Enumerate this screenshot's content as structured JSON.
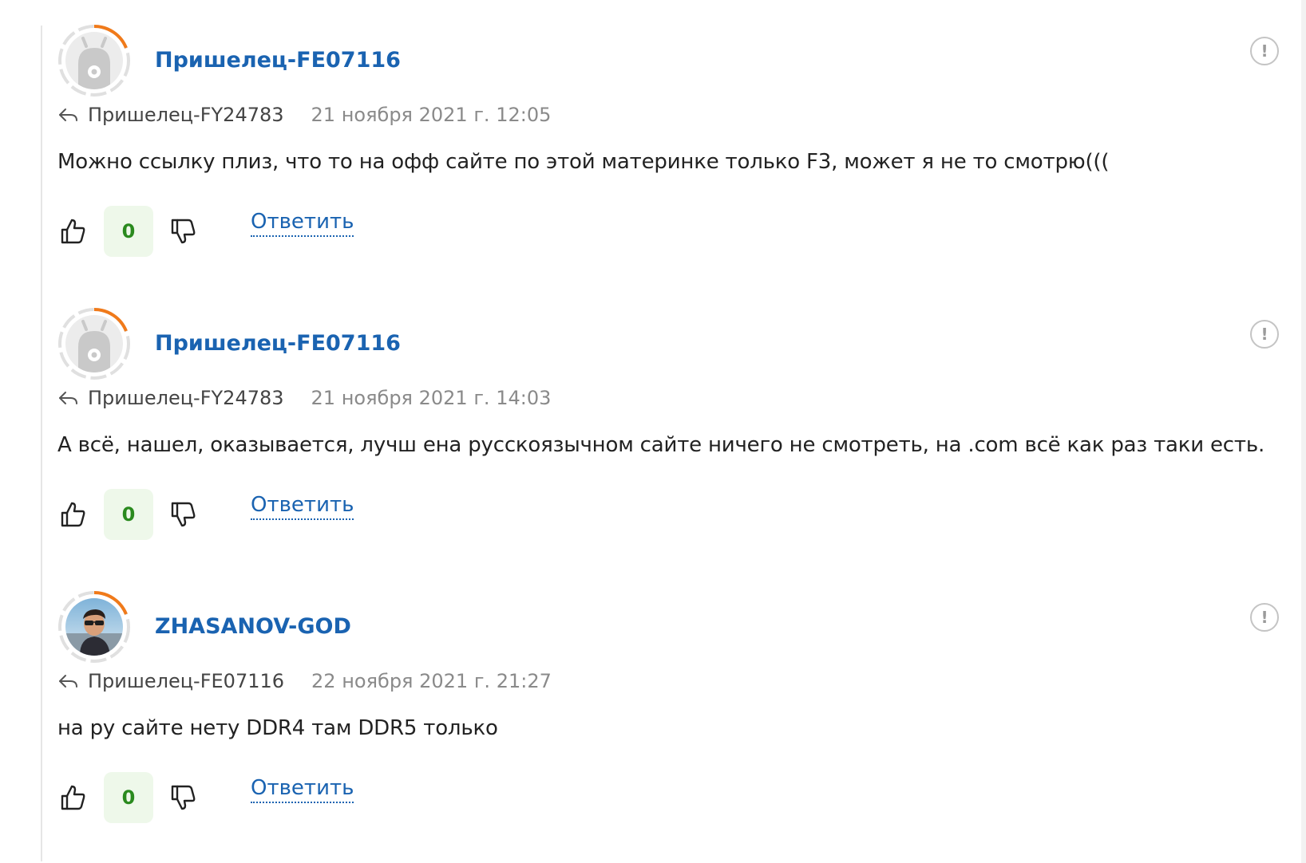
{
  "comments": [
    {
      "avatar": "alien-default-avatar",
      "author": "Пришелец-FE07116",
      "reply_to": "Пришелец-FY24783",
      "date": "21 ноября 2021 г. 12:05",
      "text": "Можно ссылку плиз, что то на офф сайте по этой материнке только F3, может я не то смотрю(((",
      "votes": "0",
      "reply_label": "Ответить",
      "report_symbol": "!"
    },
    {
      "avatar": "alien-default-avatar",
      "author": "Пришелец-FE07116",
      "reply_to": "Пришелец-FY24783",
      "date": "21 ноября 2021 г. 14:03",
      "text": "А всё, нашел, оказывается, лучш ена русскоязычном сайте ничего не смотреть, на .com всё как раз таки есть.",
      "votes": "0",
      "reply_label": "Ответить",
      "report_symbol": "!"
    },
    {
      "avatar": "user-photo-avatar",
      "author": "ZHASANOV-GOD",
      "reply_to": "Пришелец-FE07116",
      "date": "22 ноября 2021 г. 21:27",
      "text": "на ру сайте нету DDR4 там DDR5 только",
      "votes": "0",
      "reply_label": "Ответить",
      "report_symbol": "!"
    }
  ],
  "colors": {
    "author_link": "#1a63b1",
    "vote_count_bg": "#eef8ea",
    "vote_count_text": "#2a8a1e",
    "avatar_ring_accent": "#f07a1a",
    "avatar_ring_base": "#e0e0e0"
  }
}
